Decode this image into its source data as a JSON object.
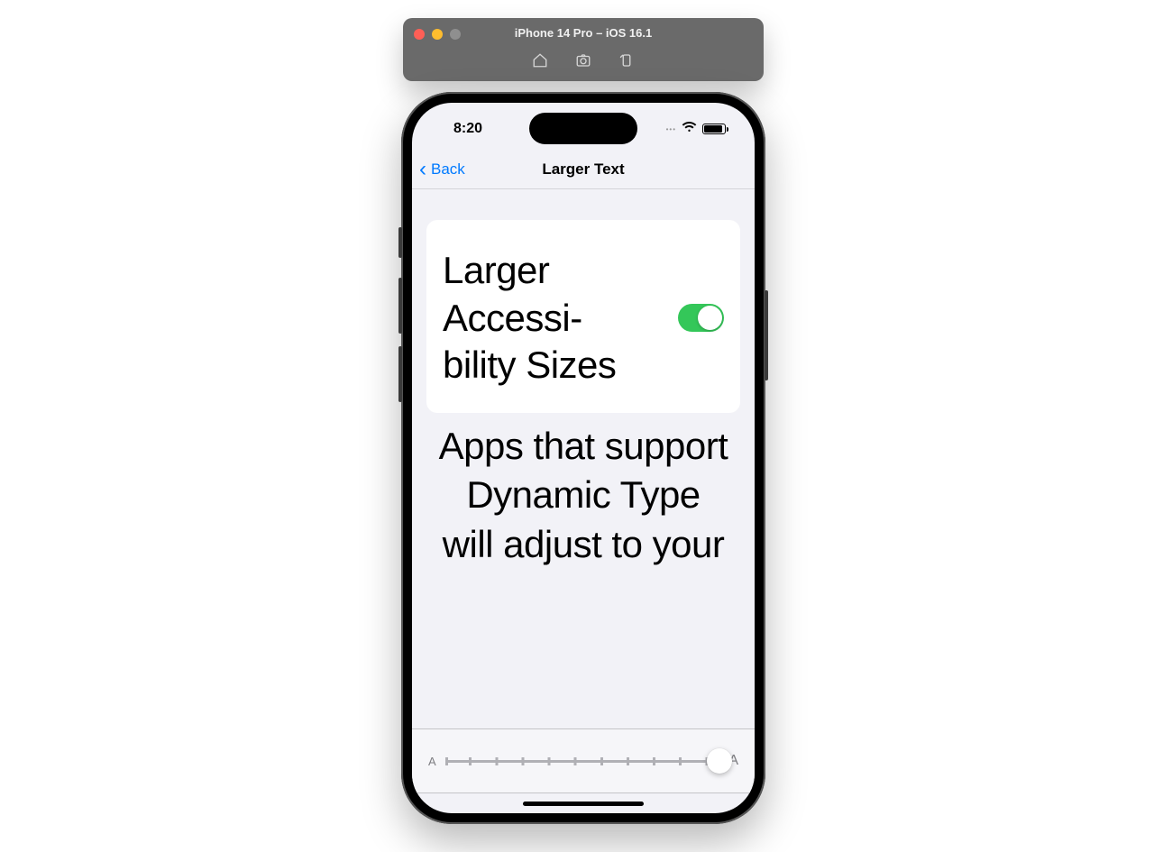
{
  "simulator": {
    "title": "iPhone 14 Pro – iOS 16.1"
  },
  "status_bar": {
    "time": "8:20"
  },
  "nav": {
    "back_label": "Back",
    "title": "Larger Text"
  },
  "settings": {
    "toggle_label": "Larger Accessi­bility Sizes",
    "toggle_on": true,
    "footer": "Apps that support Dynamic Type will adjust to your"
  },
  "slider": {
    "small_label": "A",
    "large_label": "A",
    "steps": 12,
    "value": 12
  }
}
